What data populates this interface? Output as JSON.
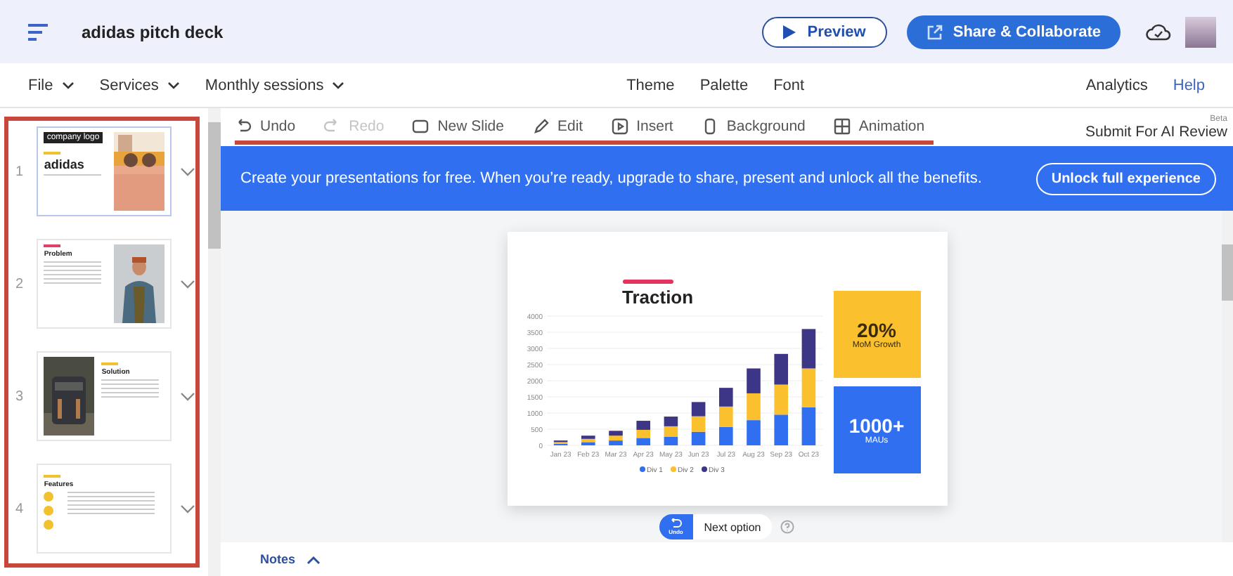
{
  "header": {
    "title": "adidas pitch deck",
    "preview": "Preview",
    "share": "Share & Collaborate"
  },
  "menu": {
    "left": [
      {
        "label": "File"
      },
      {
        "label": "Services"
      },
      {
        "label": "Monthly sessions"
      }
    ],
    "center": [
      "Theme",
      "Palette",
      "Font"
    ],
    "right": [
      {
        "label": "Analytics",
        "kind": "plain"
      },
      {
        "label": "Help",
        "kind": "link"
      }
    ]
  },
  "toolbar": {
    "items": [
      {
        "label": "Undo",
        "disabled": false
      },
      {
        "label": "Redo",
        "disabled": true
      },
      {
        "label": "New Slide",
        "disabled": false
      },
      {
        "label": "Edit",
        "disabled": false
      },
      {
        "label": "Insert",
        "disabled": false
      },
      {
        "label": "Background",
        "disabled": false
      },
      {
        "label": "Animation",
        "disabled": false
      }
    ],
    "beta": "Beta",
    "ai_review": "Submit For AI Review"
  },
  "slides": [
    {
      "number": "1",
      "kind": "cover",
      "title": "adidas",
      "tag": "company logo",
      "selected": true
    },
    {
      "number": "2",
      "kind": "text-right-photo",
      "title": "Problem",
      "selected": false
    },
    {
      "number": "3",
      "kind": "photo-left-text",
      "title": "Solution",
      "selected": false
    },
    {
      "number": "4",
      "kind": "features",
      "title": "Features",
      "selected": false
    }
  ],
  "banner": {
    "text": "Create your presentations for free. When you’re ready, upgrade to share, present and unlock all the benefits.",
    "button": "Unlock full experience"
  },
  "slide": {
    "title": "Traction",
    "stats": [
      {
        "value": "20%",
        "label": "MoM Growth",
        "color": "#fbc02d"
      },
      {
        "value": "1000+",
        "label": "MAUs",
        "color": "#2f6ff0"
      }
    ],
    "chart_data": {
      "type": "bar",
      "stacked": true,
      "grid": true,
      "legend": true,
      "categories": [
        "Jan 23",
        "Feb 23",
        "Mar 23",
        "Apr 23",
        "May 23",
        "Jun 23",
        "Jul 23",
        "Aug 23",
        "Sep 23",
        "Oct 23"
      ],
      "ylim": [
        0,
        4000
      ],
      "yticks": [
        0,
        500,
        1000,
        1500,
        2000,
        2500,
        3000,
        3500,
        4000
      ],
      "series": [
        {
          "name": "Div 1",
          "color": "#2f6ff0",
          "values": [
            50,
            100,
            150,
            230,
            270,
            420,
            570,
            780,
            950,
            1180
          ]
        },
        {
          "name": "Div 2",
          "color": "#fbc02d",
          "values": [
            50,
            100,
            150,
            250,
            320,
            480,
            630,
            830,
            930,
            1200
          ]
        },
        {
          "name": "Div 3",
          "color": "#3d3585",
          "values": [
            50,
            100,
            150,
            280,
            300,
            440,
            580,
            770,
            950,
            1220
          ]
        }
      ]
    }
  },
  "suggestion": {
    "undo": "Undo",
    "next": "Next option"
  },
  "notes": {
    "label": "Notes",
    "expanded": false
  }
}
